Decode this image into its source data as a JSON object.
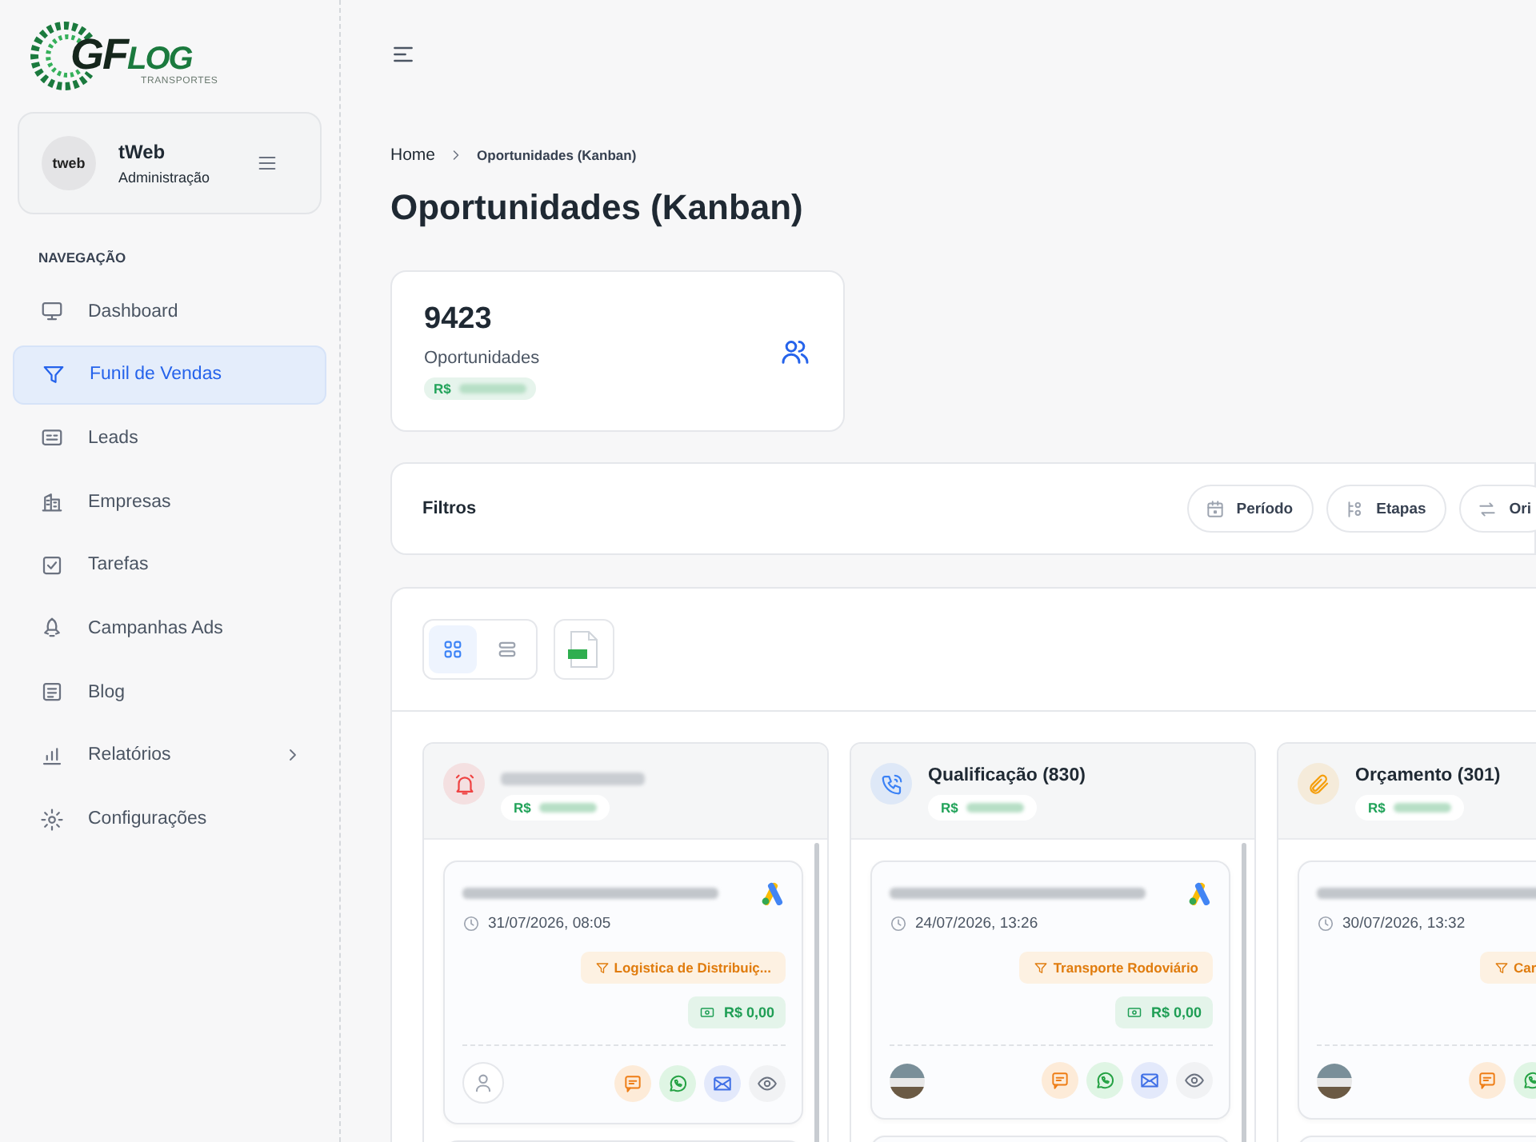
{
  "sidebar": {
    "logo": {
      "mark": "GF",
      "word": "LOG",
      "tagline": "TRANSPORTES"
    },
    "profile": {
      "avatar_logo": "tweb",
      "name": "tWeb",
      "role": "Administração"
    },
    "section_label": "NAVEGAÇÃO",
    "items": [
      {
        "label": "Dashboard",
        "selected": false,
        "expandable": false
      },
      {
        "label": "Funil de Vendas",
        "selected": true,
        "expandable": false
      },
      {
        "label": "Leads",
        "selected": false,
        "expandable": false
      },
      {
        "label": "Empresas",
        "selected": false,
        "expandable": false
      },
      {
        "label": "Tarefas",
        "selected": false,
        "expandable": false
      },
      {
        "label": "Campanhas Ads",
        "selected": false,
        "expandable": false
      },
      {
        "label": "Blog",
        "selected": false,
        "expandable": false
      },
      {
        "label": "Relatórios",
        "selected": false,
        "expandable": true
      },
      {
        "label": "Configurações",
        "selected": false,
        "expandable": false
      }
    ]
  },
  "breadcrumb": [
    "Home",
    "Oportunidades (Kanban)"
  ],
  "page_title": "Oportunidades (Kanban)",
  "stat": {
    "value": "9423",
    "label": "Oportunidades",
    "currency": "R$"
  },
  "filters": {
    "title": "Filtros",
    "buttons": [
      "Período",
      "Etapas",
      "Ori"
    ]
  },
  "view_toggle": [
    {
      "kind": "grid",
      "selected": true
    },
    {
      "kind": "list",
      "selected": false
    }
  ],
  "columns": [
    {
      "currency": "R$",
      "color": "#ef4444",
      "kind": "bell",
      "cards": [
        {
          "date": "31/07/2026, 08:05",
          "tag": "Logistica de Distribuiç...",
          "value": "R$ 0,00",
          "owner_photo": false,
          "ads": true
        }
      ]
    },
    {
      "title": "Qualificação (830)",
      "currency": "R$",
      "color": "#3b82f6",
      "kind": "phone",
      "cards": [
        {
          "date": "24/07/2026, 13:26",
          "tag": "Transporte Rodoviário",
          "value": "R$ 0,00",
          "owner_photo": true,
          "ads": true
        }
      ]
    },
    {
      "title": "Orçamento (301)",
      "currency": "R$",
      "color": "#f59e0b",
      "kind": "clip",
      "cards": [
        {
          "date": "30/07/2026, 13:32",
          "tag": "Car",
          "owner_photo": true
        }
      ]
    }
  ]
}
